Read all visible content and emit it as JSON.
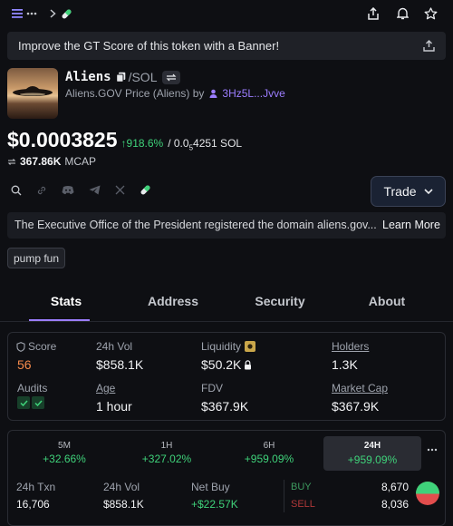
{
  "topbar": {
    "menu_icon": "menu-icon",
    "more_icon": "ellipsis-icon",
    "chevron_icon": "chevron-right-icon",
    "pill_icon": "pill-icon",
    "share_icon": "share-icon",
    "bell_icon": "bell-icon",
    "star_icon": "star-icon"
  },
  "banner": {
    "text": "Improve the GT Score of this token with a Banner!"
  },
  "token": {
    "name": "Aliens",
    "quote": "/SOL",
    "subtitle_prefix": "Aliens.GOV Price (Aliens) by",
    "creator": "3Hz5L...Jvve",
    "price": "$0.0003825",
    "change": "↑918.6%",
    "sol_prefix": "/ 0.0",
    "sol_sub": "5",
    "sol_suffix": "4251 SOL",
    "mcap_value": "367.86K",
    "mcap_label": "MCAP"
  },
  "trade_button": "Trade",
  "announcement": {
    "text": "The Executive Office of the President registered the domain aliens.gov...",
    "link": "Learn More"
  },
  "tag": "pump fun",
  "tabs": [
    {
      "label": "Stats",
      "active": true
    },
    {
      "label": "Address",
      "active": false
    },
    {
      "label": "Security",
      "active": false
    },
    {
      "label": "About",
      "active": false
    }
  ],
  "stats": {
    "score_label": "Score",
    "score_value": "56",
    "vol_label": "24h Vol",
    "vol_value": "$858.1K",
    "liq_label": "Liquidity",
    "liq_value": "$50.2K",
    "holders_label": "Holders",
    "holders_value": "1.3K",
    "audits_label": "Audits",
    "age_label": "Age",
    "age_value": "1 hour",
    "fdv_label": "FDV",
    "fdv_value": "$367.9K",
    "mcap_label": "Market Cap",
    "mcap_value": "$367.9K"
  },
  "periods": [
    {
      "label": "5M",
      "value": "+32.66%"
    },
    {
      "label": "1H",
      "value": "+327.02%"
    },
    {
      "label": "6H",
      "value": "+959.09%"
    },
    {
      "label": "24H",
      "value": "+959.09%",
      "active": true
    }
  ],
  "txn": {
    "txn_label": "24h Txn",
    "txn_value": "16,706",
    "vol_label": "24h Vol",
    "vol_value": "$858.1K",
    "netbuy_label": "Net Buy",
    "netbuy_value": "+$22.57K",
    "buy_label": "BUY",
    "buy_value": "8,670",
    "sell_label": "SELL",
    "sell_value": "8,036"
  },
  "colors": {
    "accent": "#9c7dff",
    "green": "#3fd27a",
    "red": "#e24d4d",
    "score": "#f58a4b"
  }
}
